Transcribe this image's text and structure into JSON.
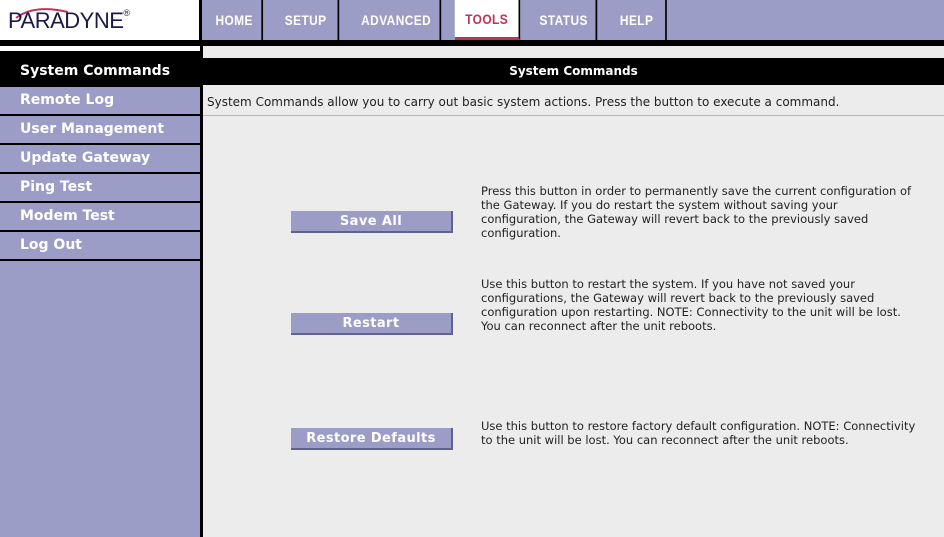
{
  "brand": {
    "logo_text": "PARADYNE",
    "trademark": "®"
  },
  "topnav": {
    "tabs": [
      {
        "label": "HOME"
      },
      {
        "label": "SETUP"
      },
      {
        "label": "ADVANCED"
      },
      {
        "label": "TOOLS",
        "active": true
      },
      {
        "label": "STATUS"
      },
      {
        "label": "HELP"
      }
    ]
  },
  "sidebar": {
    "items": [
      {
        "label": "System Commands",
        "active": true
      },
      {
        "label": "Remote Log"
      },
      {
        "label": "User Management"
      },
      {
        "label": "Update Gateway"
      },
      {
        "label": "Ping Test"
      },
      {
        "label": "Modem Test"
      },
      {
        "label": "Log Out"
      }
    ]
  },
  "content": {
    "title": "System Commands",
    "description": "System Commands allow you to carry out basic system actions. Press the button to execute a command.",
    "commands": [
      {
        "button_label": "Save All",
        "text": "Press this button in order to permanently save the current configuration of the Gateway. If you do restart the system without saving your configuration, the Gateway will revert back to the previously saved configuration."
      },
      {
        "button_label": "Restart",
        "text": "Use this button to restart the system. If you have not saved your configurations, the Gateway will revert back to the previously saved configuration upon restarting. NOTE: Connectivity to the unit will be lost. You can reconnect after the unit reboots."
      },
      {
        "button_label": "Restore Defaults",
        "text": "Use this button to restore factory default configuration. NOTE: Connectivity to the unit will be lost. You can reconnect after the unit reboots."
      }
    ]
  },
  "colors": {
    "nav_bg": "#9b9dc7",
    "active_tab_text": "#c0325a",
    "content_bg": "#ececec"
  }
}
